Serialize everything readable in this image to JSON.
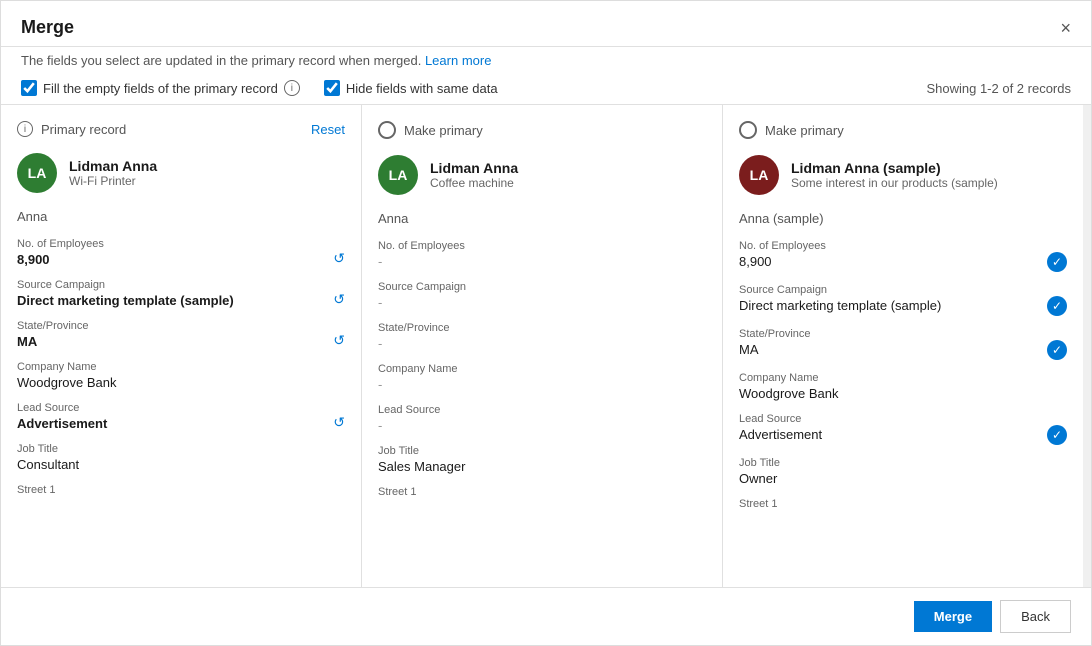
{
  "dialog": {
    "title": "Merge",
    "close_label": "×",
    "subtitle": "The fields you select are updated in the primary record when merged.",
    "learn_more": "Learn more",
    "showing": "Showing 1-2 of 2 records"
  },
  "options": {
    "fill_empty": "Fill the empty fields of the primary record",
    "hide_same": "Hide fields with same data"
  },
  "columns": [
    {
      "id": "primary",
      "header": "Primary record",
      "action": "",
      "show_reset": true,
      "reset_label": "Reset",
      "avatar_initials": "LA",
      "avatar_color": "green",
      "name": "Lidman Anna",
      "subtitle": "Wi-Fi Printer",
      "simple_name": "Anna",
      "fields": [
        {
          "label": "No. of Employees",
          "value": "8,900",
          "bold": true,
          "has_undo": true,
          "has_check": false,
          "dash": false
        },
        {
          "label": "Source Campaign",
          "value": "Direct marketing template (sample)",
          "bold": true,
          "has_undo": true,
          "has_check": false,
          "dash": false
        },
        {
          "label": "State/Province",
          "value": "MA",
          "bold": true,
          "has_undo": true,
          "has_check": false,
          "dash": false
        },
        {
          "label": "Company Name",
          "value": "Woodgrove Bank",
          "bold": false,
          "has_undo": false,
          "has_check": false,
          "dash": false
        },
        {
          "label": "Lead Source",
          "value": "Advertisement",
          "bold": true,
          "has_undo": true,
          "has_check": false,
          "dash": false
        },
        {
          "label": "Job Title",
          "value": "Consultant",
          "bold": false,
          "has_undo": false,
          "has_check": false,
          "dash": false
        },
        {
          "label": "Street 1",
          "value": "",
          "bold": false,
          "has_undo": false,
          "has_check": false,
          "dash": false
        }
      ]
    },
    {
      "id": "col2",
      "header": "Make primary",
      "action": "make_primary",
      "show_reset": false,
      "reset_label": "",
      "avatar_initials": "LA",
      "avatar_color": "green",
      "name": "Lidman Anna",
      "subtitle": "Coffee machine",
      "simple_name": "Anna",
      "fields": [
        {
          "label": "No. of Employees",
          "value": "-",
          "bold": false,
          "has_undo": false,
          "has_check": false,
          "dash": true
        },
        {
          "label": "Source Campaign",
          "value": "-",
          "bold": false,
          "has_undo": false,
          "has_check": false,
          "dash": true
        },
        {
          "label": "State/Province",
          "value": "-",
          "bold": false,
          "has_undo": false,
          "has_check": false,
          "dash": true
        },
        {
          "label": "Company Name",
          "value": "-",
          "bold": false,
          "has_undo": false,
          "has_check": false,
          "dash": true
        },
        {
          "label": "Lead Source",
          "value": "-",
          "bold": false,
          "has_undo": false,
          "has_check": false,
          "dash": true
        },
        {
          "label": "Job Title",
          "value": "Sales Manager",
          "bold": false,
          "has_undo": false,
          "has_check": false,
          "dash": false
        },
        {
          "label": "Street 1",
          "value": "",
          "bold": false,
          "has_undo": false,
          "has_check": false,
          "dash": false
        }
      ]
    },
    {
      "id": "col3",
      "header": "Make primary",
      "action": "make_primary",
      "show_reset": false,
      "reset_label": "",
      "avatar_initials": "LA",
      "avatar_color": "dark-red",
      "name": "Lidman Anna (sample)",
      "subtitle": "Some interest in our products (sample)",
      "simple_name": "Anna (sample)",
      "fields": [
        {
          "label": "No. of Employees",
          "value": "8,900",
          "bold": false,
          "has_undo": false,
          "has_check": true,
          "dash": false
        },
        {
          "label": "Source Campaign",
          "value": "Direct marketing template (sample)",
          "bold": false,
          "has_undo": false,
          "has_check": true,
          "dash": false
        },
        {
          "label": "State/Province",
          "value": "MA",
          "bold": false,
          "has_undo": false,
          "has_check": true,
          "dash": false
        },
        {
          "label": "Company Name",
          "value": "Woodgrove Bank",
          "bold": false,
          "has_undo": false,
          "has_check": false,
          "dash": false
        },
        {
          "label": "Lead Source",
          "value": "Advertisement",
          "bold": false,
          "has_undo": false,
          "has_check": true,
          "dash": false
        },
        {
          "label": "Job Title",
          "value": "Owner",
          "bold": false,
          "has_undo": false,
          "has_check": false,
          "dash": false
        },
        {
          "label": "Street 1",
          "value": "",
          "bold": false,
          "has_undo": false,
          "has_check": false,
          "dash": false
        }
      ]
    }
  ],
  "footer": {
    "merge_label": "Merge",
    "back_label": "Back"
  }
}
